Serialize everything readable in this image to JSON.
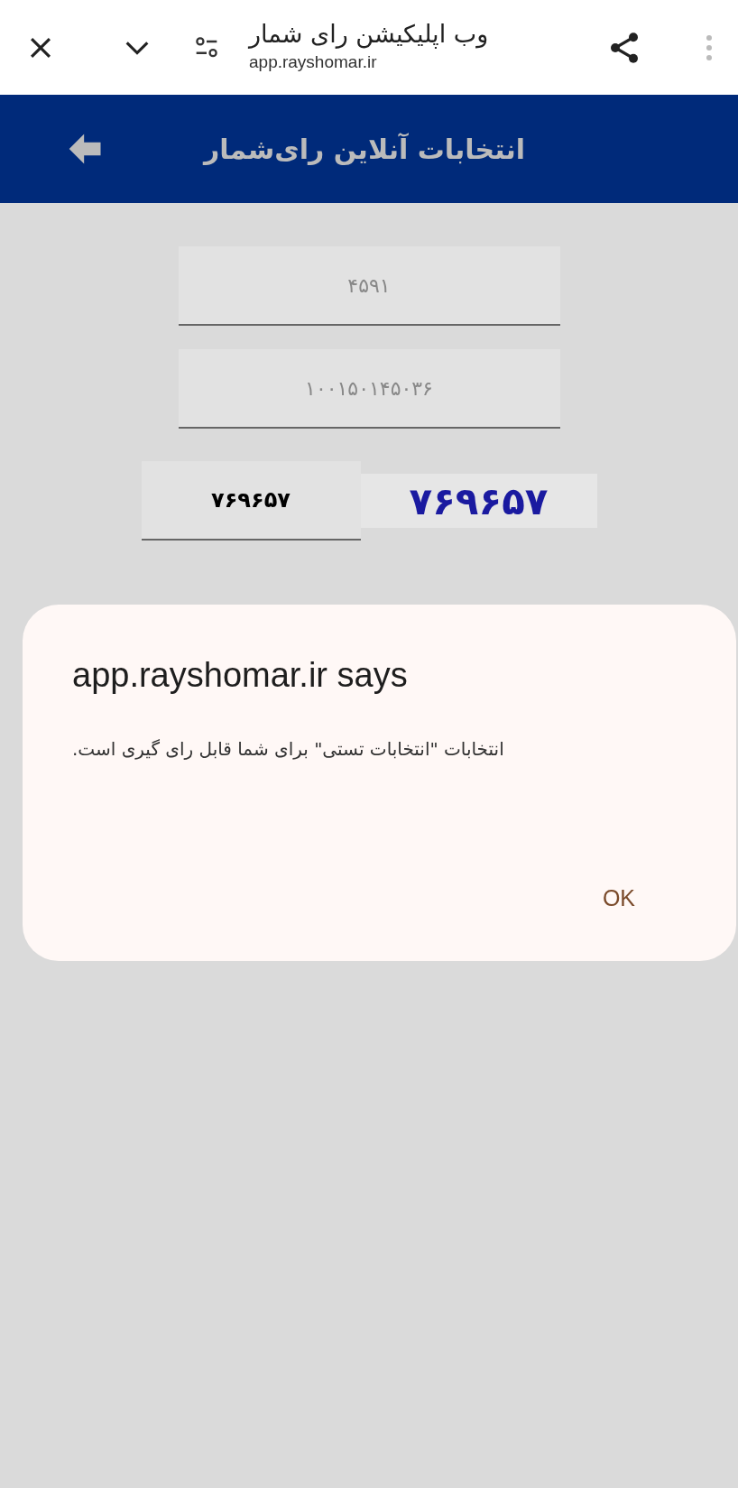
{
  "browser_bar": {
    "title": "وب اپلیکیشن رای شمار",
    "url": "app.rayshomar.ir"
  },
  "header": {
    "title": "انتخابات آنلاین رای‌شمار"
  },
  "fields": [
    {
      "value": "۴۵۹۱"
    },
    {
      "value": "۱۰۰۱۵۰۱۴۵۰۳۶"
    }
  ],
  "captcha": {
    "input_value": "۷۶۹۶۵۷",
    "image_text": "۷۶۹۶۵۷"
  },
  "dialog": {
    "title": "app.rayshomar.ir says",
    "message": "انتخابات \"انتخابات تستی\" برای شما قابل رای گیری است.",
    "button": "OK"
  }
}
